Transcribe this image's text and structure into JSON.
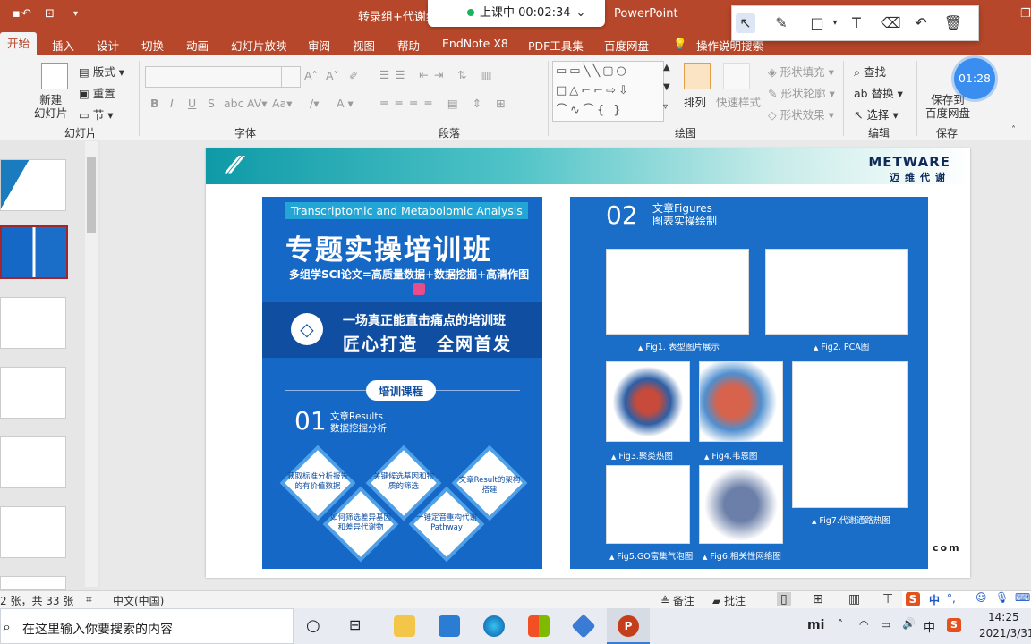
{
  "window": {
    "doc_title": "转录组+代谢组",
    "app_title": "PowerPoint",
    "class_status": "上课中 00:02:34",
    "timer": "01:28"
  },
  "tabs": [
    "开始",
    "插入",
    "设计",
    "切换",
    "动画",
    "幻灯片放映",
    "审阅",
    "视图",
    "帮助",
    "EndNote X8",
    "PDF工具集",
    "百度网盘",
    "操作说明搜索"
  ],
  "ribbon": {
    "slides": {
      "new_slide": "新建\n幻灯片",
      "layout": "版式",
      "reset": "重置",
      "section": "节",
      "group": "幻灯片"
    },
    "font": {
      "group": "字体"
    },
    "paragraph": {
      "group": "段落"
    },
    "drawing": {
      "arrange": "排列",
      "quick_styles": "快速样式",
      "fill": "形状填充",
      "outline": "形状轮廓",
      "effects": "形状效果",
      "group": "绘图"
    },
    "editing": {
      "find": "查找",
      "replace": "替换",
      "select": "选择",
      "group": "编辑"
    },
    "save": {
      "save_to": "保存到\n百度网盘",
      "group": "保存"
    }
  },
  "slide": {
    "brand_en": "METWARE",
    "brand_zh": "迈维代谢",
    "footer_fragment": "com",
    "poster1": {
      "tag": "Transcriptomic and Metabolomic Analysis",
      "title": "专题实操培训班",
      "subtitle": "多组学SCI论文=高质量数据+数据挖掘+高清作图",
      "banner_line1": "一场真正能直击痛点的培训班",
      "banner_line2": "匠心打造　全网首发",
      "course_pill": "培训课程",
      "sec_num": "01",
      "sec_label_1": "文章Results",
      "sec_label_2": "数据挖掘分析",
      "diamonds": [
        "获取标准分析报告的有价值数据",
        "关键候选基因和物质的筛选",
        "文章Result的架构搭建",
        "如何筛选差异基因和差异代谢物",
        "一锤定音重构代谢Pathway"
      ]
    },
    "poster2": {
      "sec_num": "02",
      "sec_label_1": "文章Figures",
      "sec_label_2": "图表实操绘制",
      "figures": [
        "Fig1. 表型图片展示",
        "Fig2. PCA图",
        "Fig3.聚类热图",
        "Fig4.韦恩图",
        "Fig7.代谢通路热图",
        "Fig5.GO富集气泡图",
        "Fig6.相关性网络图"
      ]
    }
  },
  "status": {
    "slide_count": "2 张，共 33 张",
    "language": "中文(中国)",
    "notes": "备注",
    "comments": "批注"
  },
  "taskbar": {
    "search_placeholder": "在这里输入你要搜索的内容",
    "time": "14:25",
    "date": "2021/3/31",
    "ime": "中"
  }
}
